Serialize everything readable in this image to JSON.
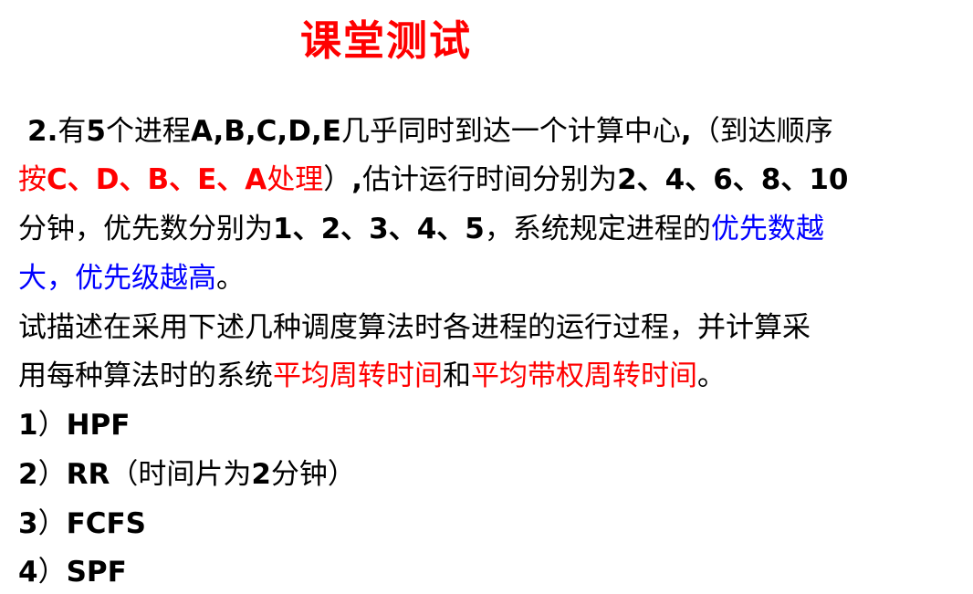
{
  "title": "课堂测试",
  "problem": {
    "l1_a": "2.",
    "l1_b": "有",
    "l1_c": "5",
    "l1_d": "个进程",
    "l1_e": "A,B,C,D,E",
    "l1_f": "几乎同时到达一个计算中心",
    "l1_g": ",",
    "l1_h": "（到达顺序",
    "l2_a": "按",
    "l2_b": "C、D、B、E、A",
    "l2_c": "处理",
    "l2_d": "）",
    "l2_e": ",",
    "l2_f": "估计运行时间分别为",
    "l2_g": "2、4、6、8、10",
    "l3_a": "分钟，优先数分别为",
    "l3_b": "1、2、3、4、5",
    "l3_c": "，系统规定进程的",
    "l3_d": "优先数越",
    "l4_a": "大，优先级越高",
    "l4_b": "。",
    "l5": "试描述在采用下述几种调度算法时各进程的运行过程，并计算采",
    "l6_a": "用每种算法时的系统",
    "l6_b": "平均周转时间",
    "l6_c": "和",
    "l6_d": "平均带权周转时间",
    "l6_e": "。"
  },
  "items": [
    {
      "num": "1",
      "paren": "）",
      "label": "HPF",
      "extra_open": "",
      "extra_num": "",
      "extra_text": "",
      "extra_close": ""
    },
    {
      "num": "2",
      "paren": "）",
      "label": "RR",
      "extra_open": "（时间片为",
      "extra_num": "2",
      "extra_text": "分钟",
      "extra_close": "）"
    },
    {
      "num": "3",
      "paren": "）",
      "label": "FCFS",
      "extra_open": "",
      "extra_num": "",
      "extra_text": "",
      "extra_close": ""
    },
    {
      "num": "4",
      "paren": "）",
      "label": "SPF",
      "extra_open": "",
      "extra_num": "",
      "extra_text": "",
      "extra_close": ""
    }
  ],
  "colors": {
    "title": "#ff0000",
    "highlight_red": "#ff0000",
    "highlight_blue": "#0000ff"
  }
}
